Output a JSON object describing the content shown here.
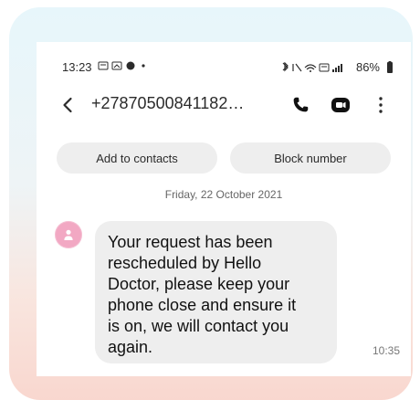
{
  "status": {
    "time": "13:23",
    "battery_percent": "86%"
  },
  "header": {
    "back_icon": "back-chevron",
    "phone_number": "+27870500841182…"
  },
  "actions": {
    "add_to_contacts": "Add to contacts",
    "block_number": "Block number"
  },
  "conversation": {
    "date": "Friday, 22 October 2021",
    "message": {
      "text": "Your request has been\nrescheduled by Hello\nDoctor, please keep your\nphone close and ensure it\nis on, we will contact you\nagain.",
      "time": "10:35"
    }
  },
  "colors": {
    "avatar": "#f2a8c3",
    "bubble": "#eeeeee",
    "pill": "#eeeeee"
  }
}
